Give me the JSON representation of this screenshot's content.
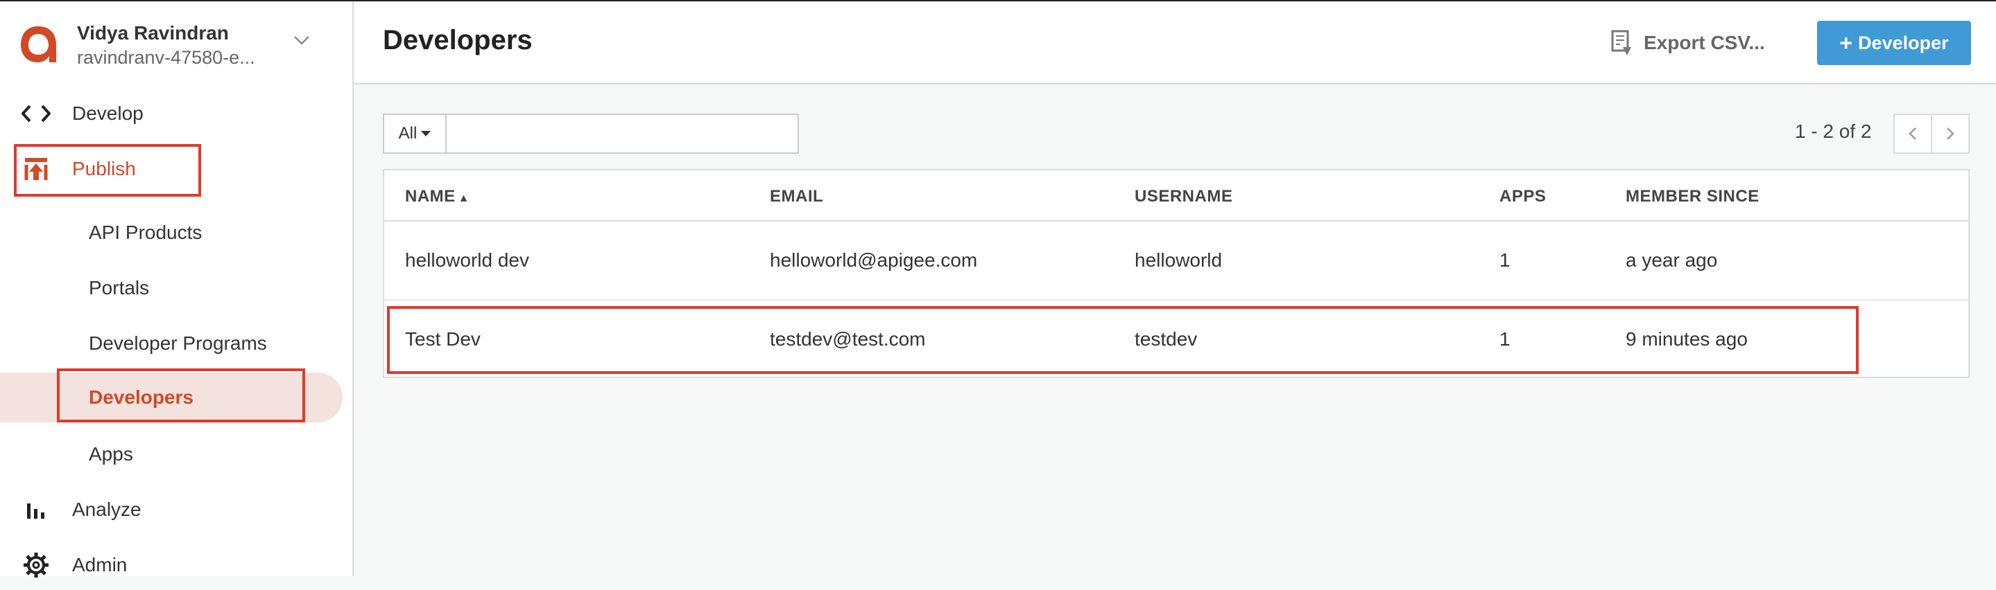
{
  "user": {
    "name": "Vidya Ravindran",
    "org": "ravindranv-47580-e..."
  },
  "nav": {
    "develop": "Develop",
    "publish": "Publish",
    "sub": [
      "API Products",
      "Portals",
      "Developer Programs",
      "Developers",
      "Apps"
    ],
    "analyze": "Analyze",
    "admin": "Admin"
  },
  "header": {
    "title": "Developers",
    "export_label": "Export CSV...",
    "add_label": "Developer"
  },
  "filter": {
    "selected": "All",
    "search_placeholder": ""
  },
  "pager": {
    "text": "1 - 2 of 2"
  },
  "table": {
    "columns": [
      "NAME",
      "EMAIL",
      "USERNAME",
      "APPS",
      "MEMBER SINCE"
    ],
    "sort_indicator": "▲",
    "rows": [
      {
        "name": "helloworld dev",
        "email": "helloworld@apigee.com",
        "username": "helloworld",
        "apps": "1",
        "member_since": "a year ago"
      },
      {
        "name": "Test Dev",
        "email": "testdev@test.com",
        "username": "testdev",
        "apps": "1",
        "member_since": "9 minutes ago"
      }
    ]
  },
  "colors": {
    "accent": "#d24927",
    "primary_button": "#3f9ad6",
    "annotation": "#e03a2c",
    "selected_bg": "#f3e2dd"
  },
  "icons": [
    "apigee-logo-icon",
    "chevron-down-icon",
    "code-icon",
    "publish-icon",
    "bar-chart-icon",
    "gear-icon",
    "export-csv-icon",
    "plus-icon",
    "chevron-left-icon",
    "chevron-right-icon"
  ]
}
